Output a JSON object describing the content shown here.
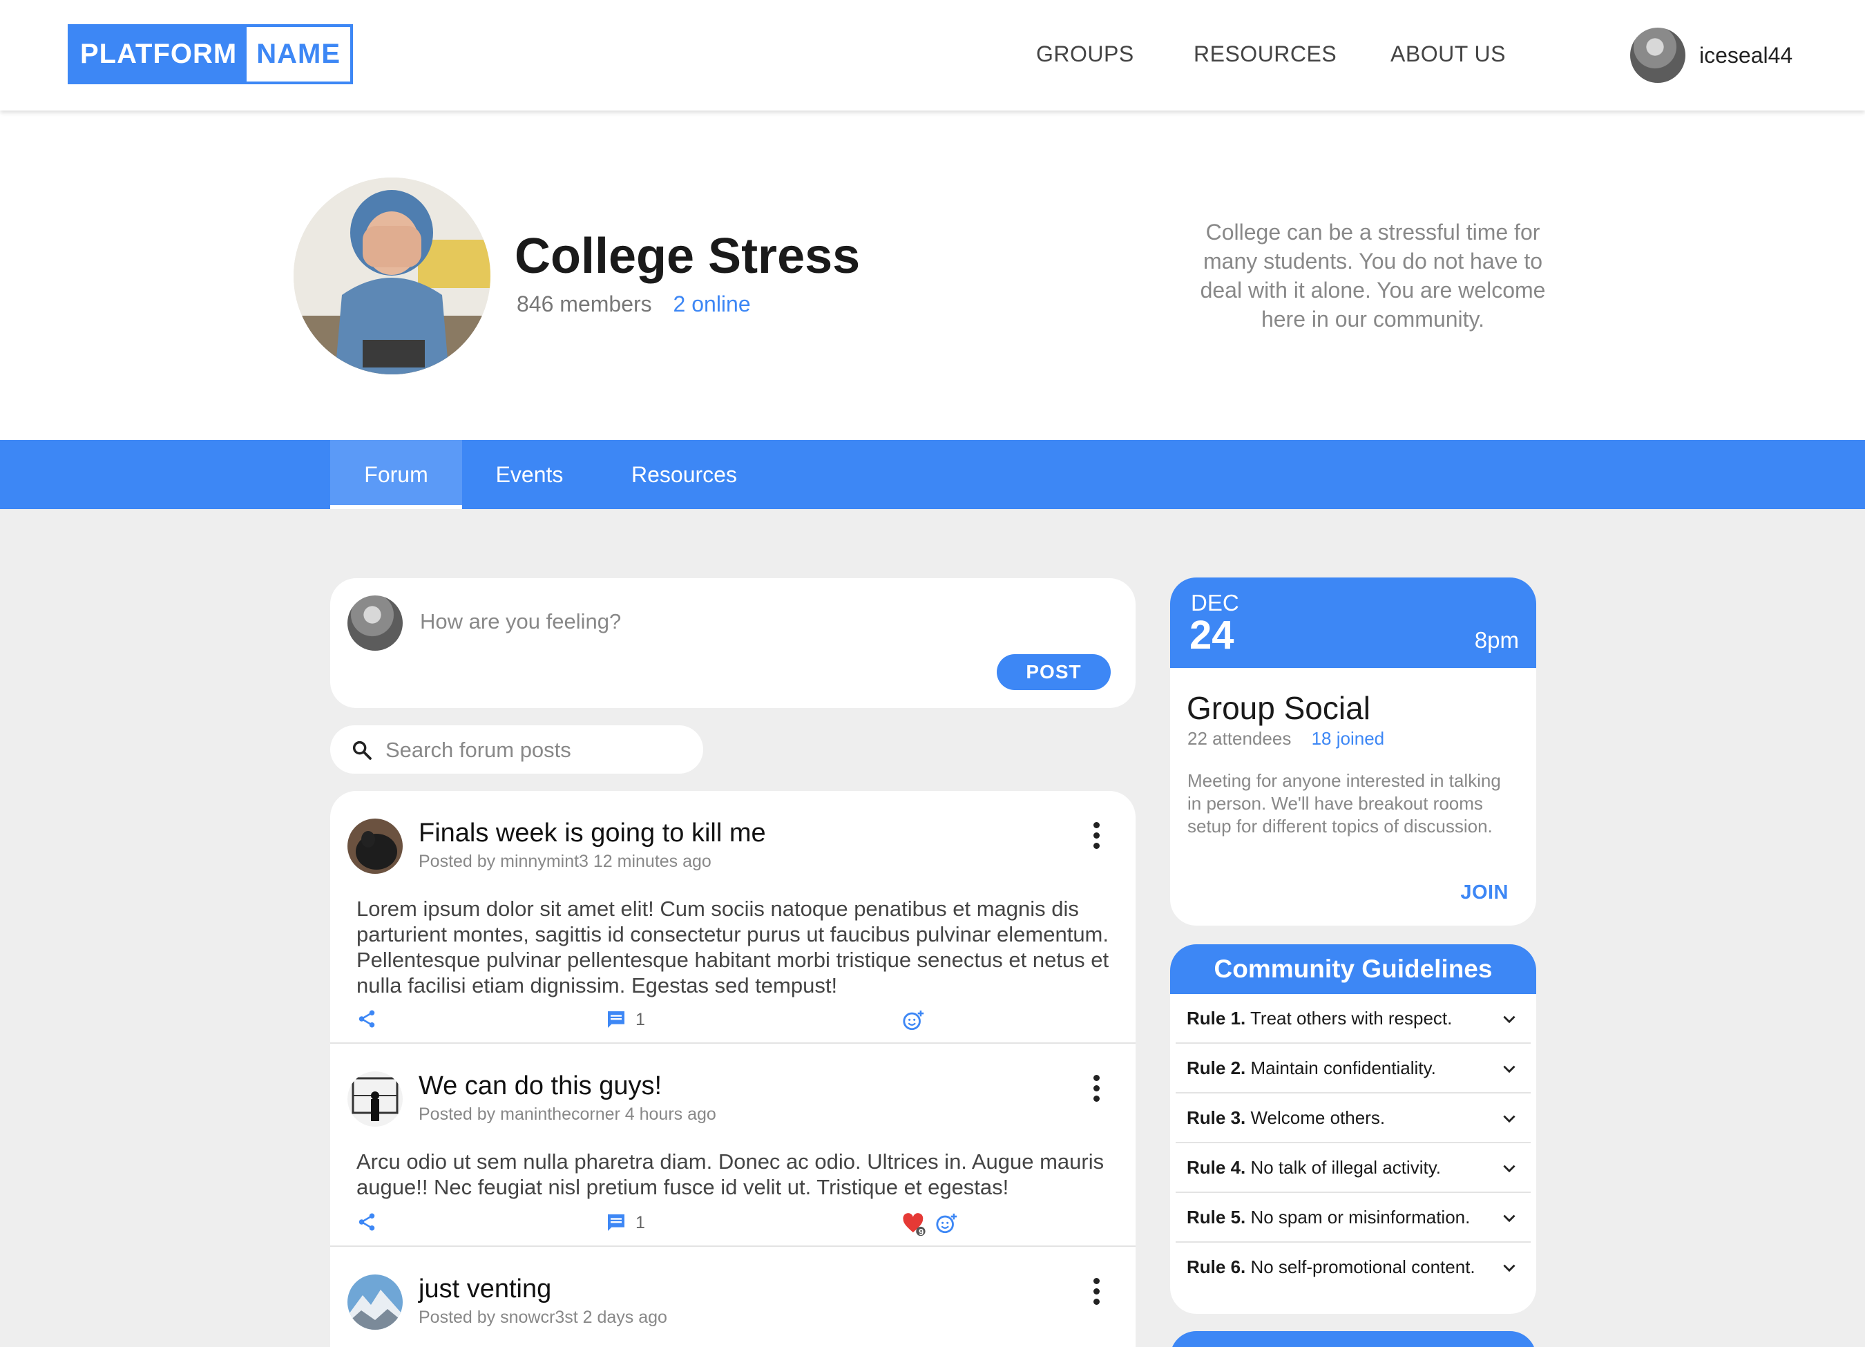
{
  "brand": {
    "part1": "PLATFORM",
    "part2": "NAME"
  },
  "nav": {
    "groups": "GROUPS",
    "resources": "RESOURCES",
    "about": "ABOUT US"
  },
  "user": {
    "name": "iceseal44"
  },
  "group": {
    "title": "College Stress",
    "members": "846 members",
    "online": "2 online",
    "description": "College can be a stressful time for many students. You do not have to deal with it alone. You are welcome here in our community."
  },
  "tabs": {
    "forum": "Forum",
    "events": "Events",
    "resources": "Resources"
  },
  "composer": {
    "placeholder": "How are you feeling?",
    "post_label": "POST"
  },
  "search": {
    "placeholder": "Search forum posts"
  },
  "posts": [
    {
      "title": "Finals week is going to kill me",
      "meta": "Posted by minnymint3 12 minutes ago",
      "body": "Lorem ipsum dolor sit amet elit! Cum sociis natoque penatibus et magnis dis parturient montes, sagittis id consectetur purus ut faucibus pulvinar elementum. Pellentesque pulvinar pellentesque habitant morbi tristique senectus et netus et nulla facilisi etiam dignissim. Egestas sed tempust!",
      "comments": "1"
    },
    {
      "title": "We can do this guys!",
      "meta": "Posted by maninthecorner 4 hours ago",
      "body": "Arcu odio ut sem nulla pharetra diam. Donec ac odio. Ultrices in. Augue mauris augue!! Nec feugiat nisl pretium fusce id velit ut. Tristique et egestas!",
      "comments": "1",
      "reaction_count": "9"
    },
    {
      "title": "just venting",
      "meta": "Posted by snowcr3st 2 days ago"
    }
  ],
  "event": {
    "month": "DEC",
    "day": "24",
    "time": "8pm",
    "title": "Group Social",
    "attendees": "22 attendees",
    "joined": "18 joined",
    "description": "Meeting for anyone interested in talking in person. We'll have breakout rooms setup for different topics of discussion.",
    "join_label": "JOIN"
  },
  "guidelines": {
    "title": "Community Guidelines",
    "rules": [
      {
        "label": "Rule 1.",
        "text": " Treat others with respect."
      },
      {
        "label": "Rule 2.",
        "text": " Maintain confidentiality."
      },
      {
        "label": "Rule 3.",
        "text": " Welcome others."
      },
      {
        "label": "Rule 4.",
        "text": " No talk of illegal activity."
      },
      {
        "label": "Rule 5.",
        "text": " No spam or misinformation."
      },
      {
        "label": "Rule 6.",
        "text": " No self-promotional content."
      }
    ]
  },
  "colors": {
    "accent": "#3d87f5",
    "heart": "#e53935"
  }
}
